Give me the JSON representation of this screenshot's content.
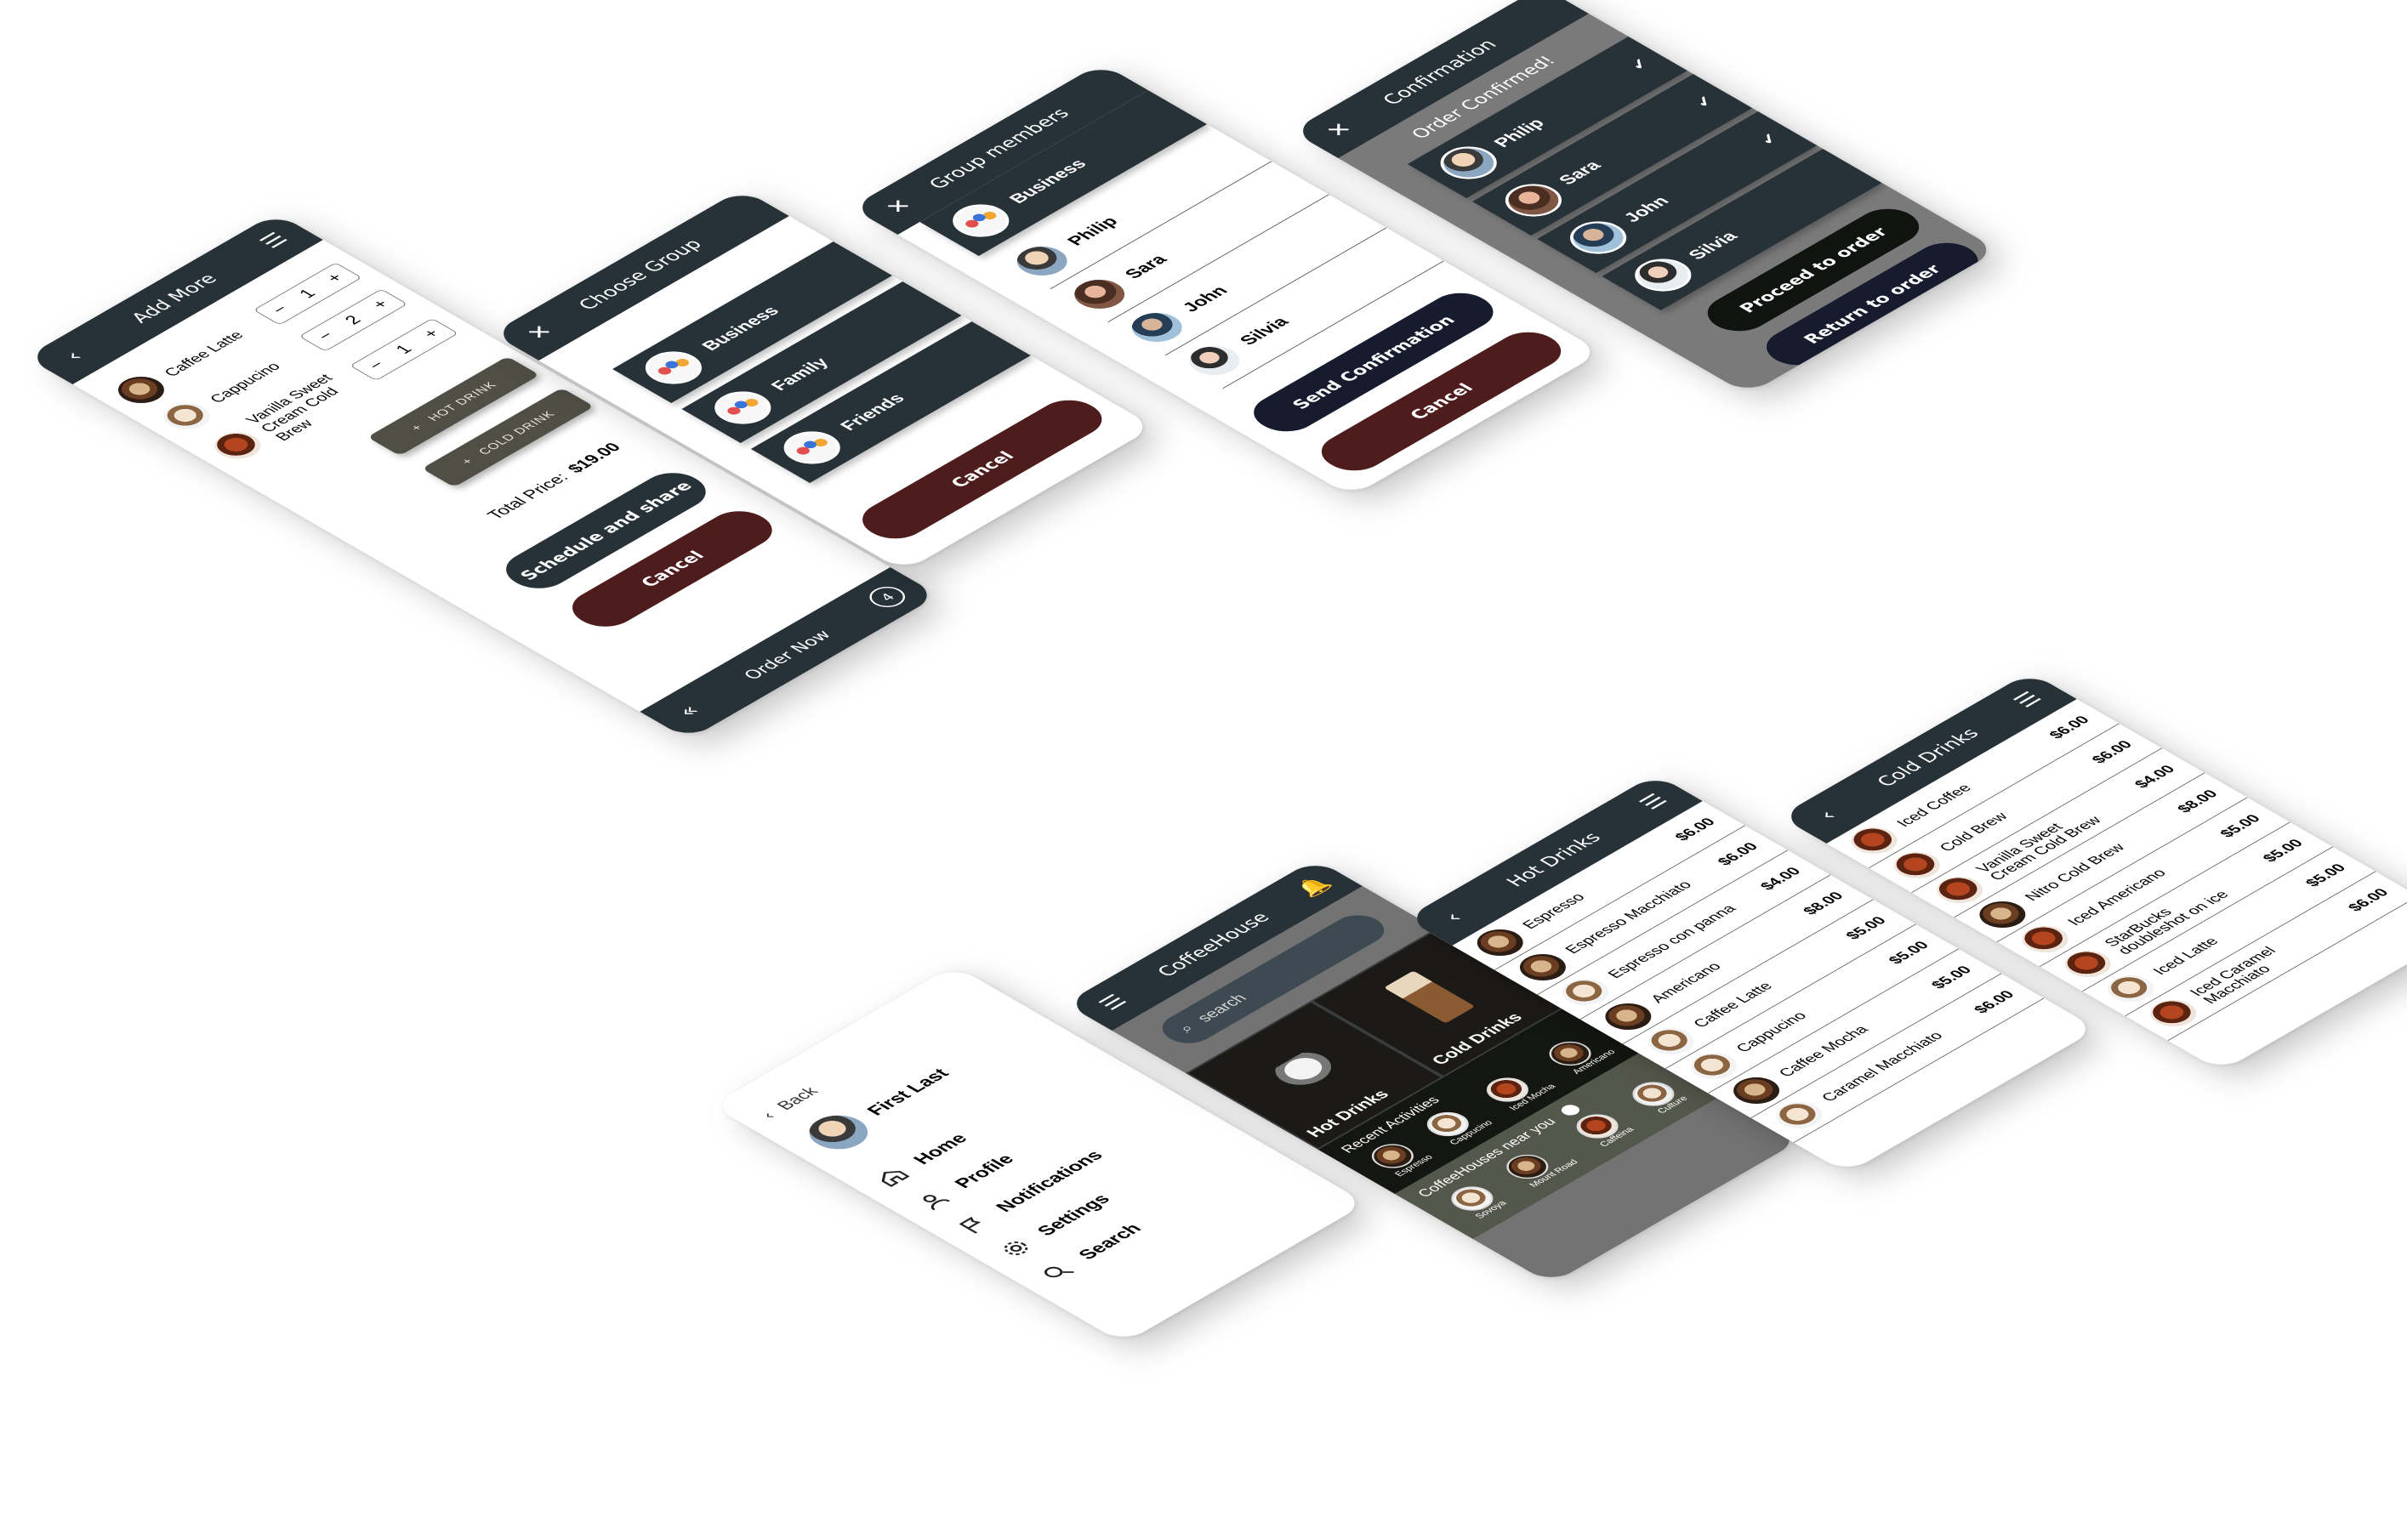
{
  "add_more": {
    "title": "Add More",
    "items": [
      {
        "name": "Caffee Latte",
        "qty": "1"
      },
      {
        "name": "Cappucino",
        "qty": "2"
      },
      {
        "name": "Vanilla Sweet Cream Cold Brew",
        "qty": "1"
      }
    ],
    "minus": "−",
    "plus": "+",
    "hot_drink": "HOT DRINK",
    "cold_drink": "COLD DRINK",
    "total_label": "Total Price:",
    "total_value": "$19.00",
    "schedule_label": "Schedule and share",
    "cancel_label": "Cancel",
    "order_now_label": "Order Now",
    "order_count": "4",
    "back_glyph": "«"
  },
  "choose_group": {
    "title": "Choose Group",
    "groups": [
      "Business",
      "Family",
      "Friends"
    ],
    "cancel_label": "Cancel"
  },
  "group_members": {
    "title": "Group members",
    "group_name": "Business",
    "members": [
      "Philip",
      "Sara",
      "John",
      "Silvia"
    ],
    "send_label": "Send Confirmation",
    "cancel_label": "Cancel"
  },
  "confirmation": {
    "title": "Confirmation",
    "banner": "Order Confirmed!",
    "members": [
      "Philip",
      "Sara",
      "John",
      "Silvia"
    ],
    "proceed_label": "Proceed to order",
    "return_label": "Return to order"
  },
  "sidebar": {
    "back_label": "Back",
    "user_name": "First Last",
    "items": [
      "Home",
      "Profile",
      "Notifications",
      "Settings",
      "Search"
    ]
  },
  "home": {
    "title": "CoffeeHouse",
    "search_placeholder": "search",
    "hot_label": "Hot Drinks",
    "cold_label": "Cold Drinks",
    "recent_title": "Recent Activities",
    "recent": [
      "Espresso",
      "Cappucino",
      "Iced Mocha",
      "Americano"
    ],
    "near_title": "CoffeeHouses near you",
    "near": [
      "Sovoya",
      "Mount Road",
      "Caffeina",
      "Culture"
    ]
  },
  "hot_drinks": {
    "title": "Hot Drinks",
    "items": [
      {
        "name": "Espresso",
        "price": "$6.00"
      },
      {
        "name": "Espresso Macchiato",
        "price": "$6.00"
      },
      {
        "name": "Espresso con panna",
        "price": "$4.00"
      },
      {
        "name": "Americano",
        "price": "$8.00"
      },
      {
        "name": "Caffee Latte",
        "price": "$5.00"
      },
      {
        "name": "Cappucino",
        "price": "$5.00"
      },
      {
        "name": "Caffee Mocha",
        "price": "$5.00"
      },
      {
        "name": "Caramel Macchiato",
        "price": "$6.00"
      }
    ]
  },
  "cold_drinks": {
    "title": "Cold Drinks",
    "items": [
      {
        "name": "Iced Coffee",
        "price": "$6.00"
      },
      {
        "name": "Cold Brew",
        "price": "$6.00"
      },
      {
        "name": "Vanilla Sweet Cream Cold Brew",
        "price": "$4.00"
      },
      {
        "name": "Nitro Cold Brew",
        "price": "$8.00"
      },
      {
        "name": "Iced Americano",
        "price": "$5.00"
      },
      {
        "name": "StarBucks doubleshot on ice",
        "price": "$5.00"
      },
      {
        "name": "Iced Latte",
        "price": "$5.00"
      },
      {
        "name": "Iced Caramel Macchiato",
        "price": "$6.00"
      }
    ]
  }
}
